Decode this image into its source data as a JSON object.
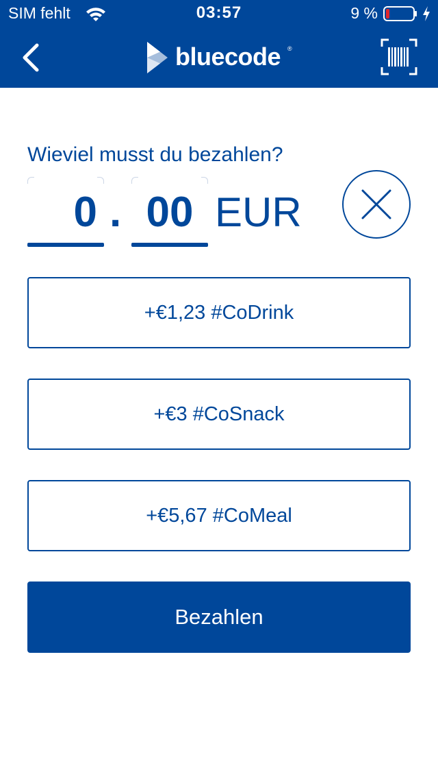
{
  "status_bar": {
    "carrier": "SIM fehlt",
    "time": "03:57",
    "battery_percent": "9 %",
    "battery_level": 0.09
  },
  "nav": {
    "back_icon": "chevron-left-icon",
    "logo_text": "bluecode",
    "logo_reg": "®",
    "scan_icon": "barcode-scan-icon"
  },
  "payment": {
    "prompt": "Wieviel musst du bezahlen?",
    "amount_whole": "0",
    "decimal_separator": ".",
    "amount_cents": "00",
    "currency": "EUR",
    "clear_icon": "close-icon"
  },
  "quick_amounts": [
    {
      "label": "+€1,23 #CoDrink"
    },
    {
      "label": "+€3 #CoSnack"
    },
    {
      "label": "+€5,67 #CoMeal"
    }
  ],
  "pay_button": {
    "label": "Bezahlen"
  },
  "colors": {
    "brand": "#00479a",
    "background": "#ffffff",
    "battery_low": "#e0262b"
  }
}
